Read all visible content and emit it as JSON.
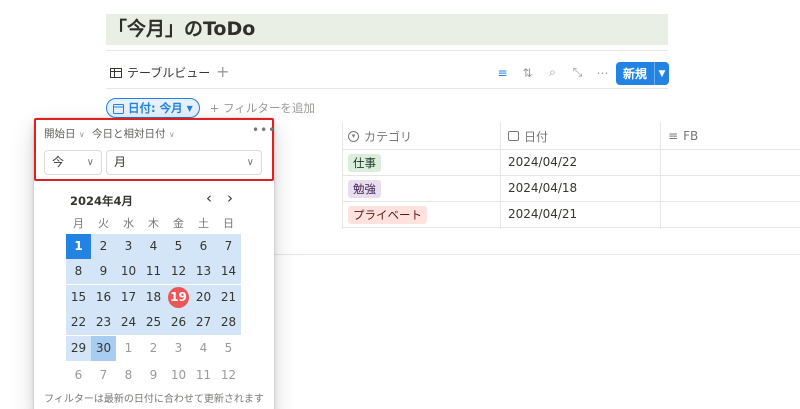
{
  "page": {
    "title": "「今月」のToDo"
  },
  "view": {
    "tab_label": "テーブルビュー",
    "add_view": "+",
    "new_button": "新規"
  },
  "filters": {
    "active_chip": "日付: 今月",
    "add_filter": "+ フィルターを追加"
  },
  "table": {
    "columns": [
      "カテゴリ",
      "日付",
      "FB"
    ],
    "rows": [
      {
        "category": "仕事",
        "category_color": "#dbeddb",
        "category_text": "#1c3829",
        "date": "2024/04/22"
      },
      {
        "category": "勉強",
        "category_color": "#e8deee",
        "category_text": "#412454",
        "date": "2024/04/18"
      },
      {
        "category": "プライベート",
        "category_color": "#ffe2dd",
        "category_text": "#5d1715",
        "date": "2024/04/21"
      }
    ]
  },
  "popup": {
    "prop_start": "開始日",
    "prop_relative": "今日と相対日付",
    "more": "•••",
    "select_when": "今",
    "select_unit": "月",
    "month_label": "2024年4月",
    "prev": "‹",
    "next": "›",
    "weekdays": [
      "月",
      "火",
      "水",
      "木",
      "金",
      "土",
      "日"
    ],
    "weeks": [
      [
        "1",
        "2",
        "3",
        "4",
        "5",
        "6",
        "7"
      ],
      [
        "8",
        "9",
        "10",
        "11",
        "12",
        "13",
        "14"
      ],
      [
        "15",
        "16",
        "17",
        "18",
        "19",
        "20",
        "21"
      ],
      [
        "22",
        "23",
        "24",
        "25",
        "26",
        "27",
        "28"
      ],
      [
        "29",
        "30",
        "1",
        "2",
        "3",
        "4",
        "5"
      ],
      [
        "6",
        "7",
        "8",
        "9",
        "10",
        "11",
        "12"
      ]
    ],
    "today": "19",
    "footer": "フィルターは最新の日付に合わせて更新されます"
  },
  "colors": {
    "accent": "#2383e2",
    "today": "#eb5757",
    "highlight": "#e02020"
  }
}
